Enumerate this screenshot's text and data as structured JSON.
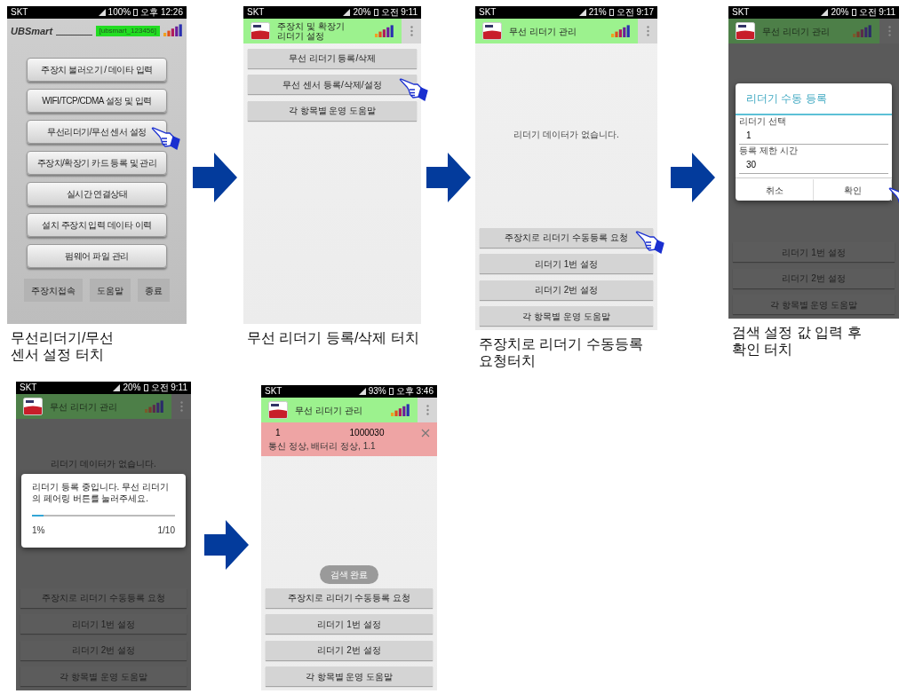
{
  "steps": [
    {
      "screen": {
        "kind": "main_menu",
        "dimmed": false,
        "status": {
          "carrier": "SKT",
          "battery": "100%",
          "time": "오후 12:26"
        },
        "header": {
          "kind": "logo_line",
          "logo": "UBSmart",
          "badge": "[ubsmart_123456]"
        },
        "menu": [
          {
            "label": "주장치 불러오기 / 데이타 입력",
            "touched": false
          },
          {
            "label": "WIFI/TCP/CDMA 설정 및 입력",
            "touched": false
          },
          {
            "label": "무선리더기/무선 센서 설정",
            "touched": true
          },
          {
            "label": "주장치/확장기 카드 등록 및 관리",
            "touched": false
          },
          {
            "label": "실시간 연결상태",
            "touched": false
          },
          {
            "label": "설치 주장치 입력 데이타 이력",
            "touched": false
          },
          {
            "label": "펌웨어 파일 관리",
            "touched": false
          }
        ],
        "footer_buttons": [
          "주장치접속",
          "도움말",
          "종료"
        ]
      },
      "caption": [
        "무선리더기/무선",
        "센서 설정 터치"
      ]
    },
    {
      "screen": {
        "kind": "app",
        "dimmed": false,
        "status": {
          "carrier": "SKT",
          "battery": "20%",
          "time": "오전 9:11"
        },
        "header": {
          "kind": "app_bar",
          "title_lines": [
            "주장치 및 확장기",
            "리더기 설정"
          ]
        },
        "top_buttons": [
          {
            "label": "무선 리더기 등록/삭제",
            "touched": false
          },
          {
            "label": "무선 센서 등록/삭제/설정",
            "touched": true
          },
          {
            "label": "각 항목별 운영 도움말",
            "touched": false
          }
        ]
      },
      "caption": [
        "무선 리더기 등록/삭제 터치"
      ]
    },
    {
      "screen": {
        "kind": "app",
        "dimmed": false,
        "status": {
          "carrier": "SKT",
          "battery": "21%",
          "time": "오전 9:17"
        },
        "header": {
          "kind": "app_bar",
          "title_lines": [
            "무선 리더기 관리"
          ]
        },
        "message": "리더기 데이터가 없습니다.",
        "bottom_buttons": [
          {
            "label": "주장치로 리더기 수동등록 요청",
            "touched": true
          },
          {
            "label": "리더기 1번 설정",
            "touched": false
          },
          {
            "label": "리더기 2번 설정",
            "touched": false
          },
          {
            "label": "각 항목별 운영 도움말",
            "touched": false
          }
        ]
      },
      "caption": [
        "주장치로 리더기 수동등록",
        "요청터치"
      ]
    },
    {
      "screen": {
        "kind": "app",
        "dimmed": true,
        "status": {
          "carrier": "SKT",
          "battery": "20%",
          "time": "오전 9:11"
        },
        "header": {
          "kind": "app_bar",
          "title_lines": [
            "무선 리더기 관리"
          ]
        },
        "bottom_buttons": [
          {
            "label": "리더기 1번 설정",
            "touched": false
          },
          {
            "label": "리더기 2번 설정",
            "touched": false
          },
          {
            "label": "각 항목별 운영 도움말",
            "touched": false
          }
        ],
        "dialog": {
          "kind": "form",
          "title": "리더기 수동 등록",
          "fields": [
            {
              "label": "리더기 선택",
              "value": "1"
            },
            {
              "label": "등록 제한 시간",
              "value": "30"
            }
          ],
          "actions": [
            {
              "label": "취소",
              "touched": false
            },
            {
              "label": "확인",
              "touched": true
            }
          ]
        }
      },
      "caption": [
        "검색 설정 값 입력 후",
        "확인 터치"
      ]
    },
    {
      "screen": {
        "kind": "app",
        "dimmed": true,
        "status": {
          "carrier": "SKT",
          "battery": "20%",
          "time": "오전 9:11"
        },
        "header": {
          "kind": "app_bar",
          "title_lines": [
            "무선 리더기 관리"
          ]
        },
        "message": "리더기 데이터가 없습니다.",
        "bottom_buttons": [
          {
            "label": "주장치로 리더기 수동등록 요청",
            "touched": false
          },
          {
            "label": "리더기 1번 설정",
            "touched": false
          },
          {
            "label": "리더기 2번 설정",
            "touched": false
          },
          {
            "label": "각 항목별 운영 도움말",
            "touched": false
          }
        ],
        "dialog": {
          "kind": "progress",
          "message": "리더기 등록 중입니다. 무선 리더기의 페어링 버튼를 눌러주세요.",
          "level": 0.08,
          "percent": "1%",
          "count": "1/10"
        }
      }
    },
    {
      "screen": {
        "kind": "app",
        "dimmed": false,
        "status": {
          "carrier": "SKT",
          "battery": "93%",
          "time": "오후 3:46"
        },
        "header": {
          "kind": "app_bar",
          "title_lines": [
            "무선 리더기 관리"
          ]
        },
        "rows": [
          {
            "number": "1",
            "id": "1000030",
            "detail": "통신 정상, 배터리 정상, 1.1"
          }
        ],
        "bottom_buttons": [
          {
            "label": "주장치로 리더기 수동등록 요청",
            "touched": false
          },
          {
            "label": "리더기 1번 설정",
            "touched": false
          },
          {
            "label": "리더기 2번 설정",
            "touched": false
          },
          {
            "label": "각 항목별 운영 도움말",
            "touched": false
          }
        ],
        "toast": "검색 완료"
      }
    }
  ]
}
